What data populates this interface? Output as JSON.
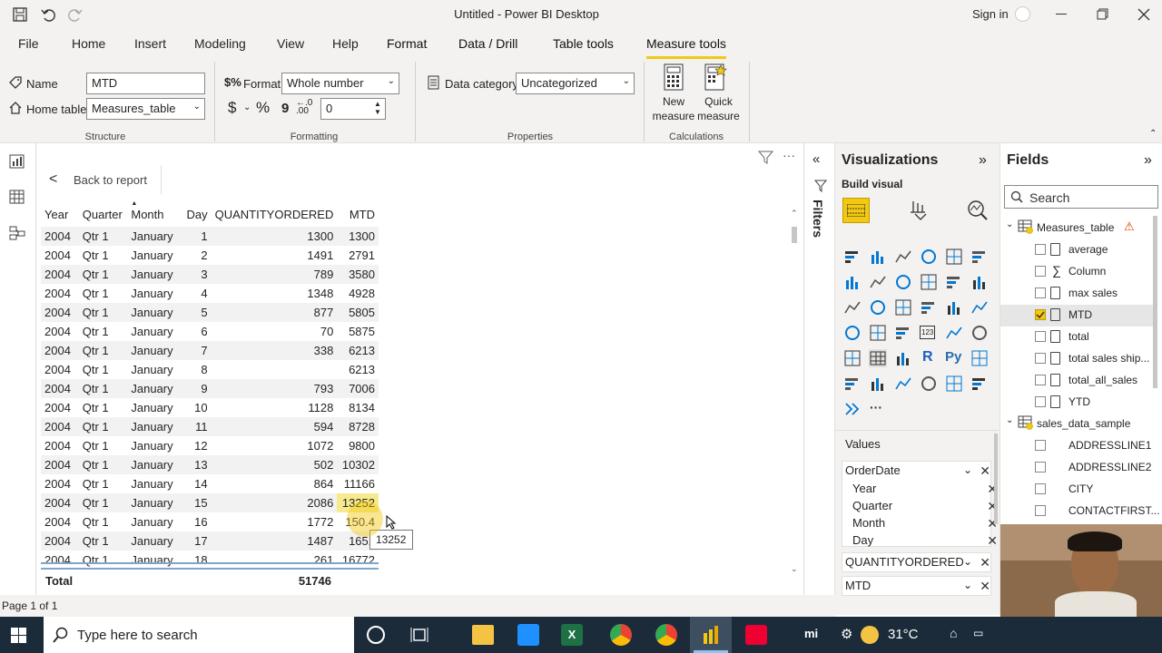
{
  "window": {
    "title": "Untitled - Power BI Desktop",
    "signin": "Sign in"
  },
  "menu": {
    "file": "File",
    "home": "Home",
    "insert": "Insert",
    "modeling": "Modeling",
    "view": "View",
    "help": "Help",
    "format": "Format",
    "data_drill": "Data / Drill",
    "table_tools": "Table tools",
    "measure_tools": "Measure tools"
  },
  "ribbon": {
    "name_label": "Name",
    "name_value": "MTD",
    "home_table_label": "Home table",
    "home_table_value": "Measures_table",
    "format_label": "Format",
    "format_value": "Whole number",
    "currency": "$",
    "percent": "%",
    "comma": "9",
    "decimals_value": "0",
    "data_category_label": "Data category",
    "data_category_value": "Uncategorized",
    "new_measure": "New measure",
    "quick_measure": "Quick measure",
    "groups": {
      "structure": "Structure",
      "formatting": "Formatting",
      "properties": "Properties",
      "calculations": "Calculations"
    }
  },
  "report": {
    "back": "Back to report",
    "page_info": "Page 1 of 1",
    "tooltip": "13252"
  },
  "table": {
    "headers": [
      "Year",
      "Quarter",
      "Month",
      "Day",
      "QUANTITYORDERED",
      "MTD"
    ],
    "rows": [
      [
        "2004",
        "Qtr 1",
        "January",
        "1",
        "1300",
        "1300"
      ],
      [
        "2004",
        "Qtr 1",
        "January",
        "2",
        "1491",
        "2791"
      ],
      [
        "2004",
        "Qtr 1",
        "January",
        "3",
        "789",
        "3580"
      ],
      [
        "2004",
        "Qtr 1",
        "January",
        "4",
        "1348",
        "4928"
      ],
      [
        "2004",
        "Qtr 1",
        "January",
        "5",
        "877",
        "5805"
      ],
      [
        "2004",
        "Qtr 1",
        "January",
        "6",
        "70",
        "5875"
      ],
      [
        "2004",
        "Qtr 1",
        "January",
        "7",
        "338",
        "6213"
      ],
      [
        "2004",
        "Qtr 1",
        "January",
        "8",
        "",
        "6213"
      ],
      [
        "2004",
        "Qtr 1",
        "January",
        "9",
        "793",
        "7006"
      ],
      [
        "2004",
        "Qtr 1",
        "January",
        "10",
        "1128",
        "8134"
      ],
      [
        "2004",
        "Qtr 1",
        "January",
        "11",
        "594",
        "8728"
      ],
      [
        "2004",
        "Qtr 1",
        "January",
        "12",
        "1072",
        "9800"
      ],
      [
        "2004",
        "Qtr 1",
        "January",
        "13",
        "502",
        "10302"
      ],
      [
        "2004",
        "Qtr 1",
        "January",
        "14",
        "864",
        "11166"
      ],
      [
        "2004",
        "Qtr 1",
        "January",
        "15",
        "2086",
        "13252"
      ],
      [
        "2004",
        "Qtr 1",
        "January",
        "16",
        "1772",
        "150.4"
      ],
      [
        "2004",
        "Qtr 1",
        "January",
        "17",
        "1487",
        "1651"
      ],
      [
        "2004",
        "Qtr 1",
        "January",
        "18",
        "261",
        "16772"
      ]
    ],
    "total_label": "Total",
    "total_qty": "51746"
  },
  "filters": {
    "label": "Filters"
  },
  "visualizations": {
    "title": "Visualizations",
    "build_visual": "Build visual",
    "values_label": "Values",
    "wells": [
      {
        "label": "OrderDate"
      },
      {
        "label": "Year"
      },
      {
        "label": "Quarter"
      },
      {
        "label": "Month"
      },
      {
        "label": "Day"
      },
      {
        "label": "QUANTITYORDERED"
      },
      {
        "label": "MTD"
      }
    ],
    "r_icon": "R",
    "py_icon": "Py",
    "more": "···",
    "num_icon": "123"
  },
  "fields": {
    "title": "Fields",
    "search_placeholder": "Search",
    "measures_table": "Measures_table",
    "measures": [
      "average",
      "Column",
      "max sales",
      "MTD",
      "total",
      "total sales ship...",
      "total_all_sales",
      "YTD"
    ],
    "sales_table": "sales_data_sample",
    "sales_fields": [
      "ADDRESSLINE1",
      "ADDRESSLINE2",
      "CITY",
      "CONTACTFIRST..."
    ]
  },
  "taskbar": {
    "search": "Type here to search",
    "temp": "31°C"
  },
  "colors": {
    "accent": "#f2c811",
    "taskbar": "#1c2b3a"
  }
}
